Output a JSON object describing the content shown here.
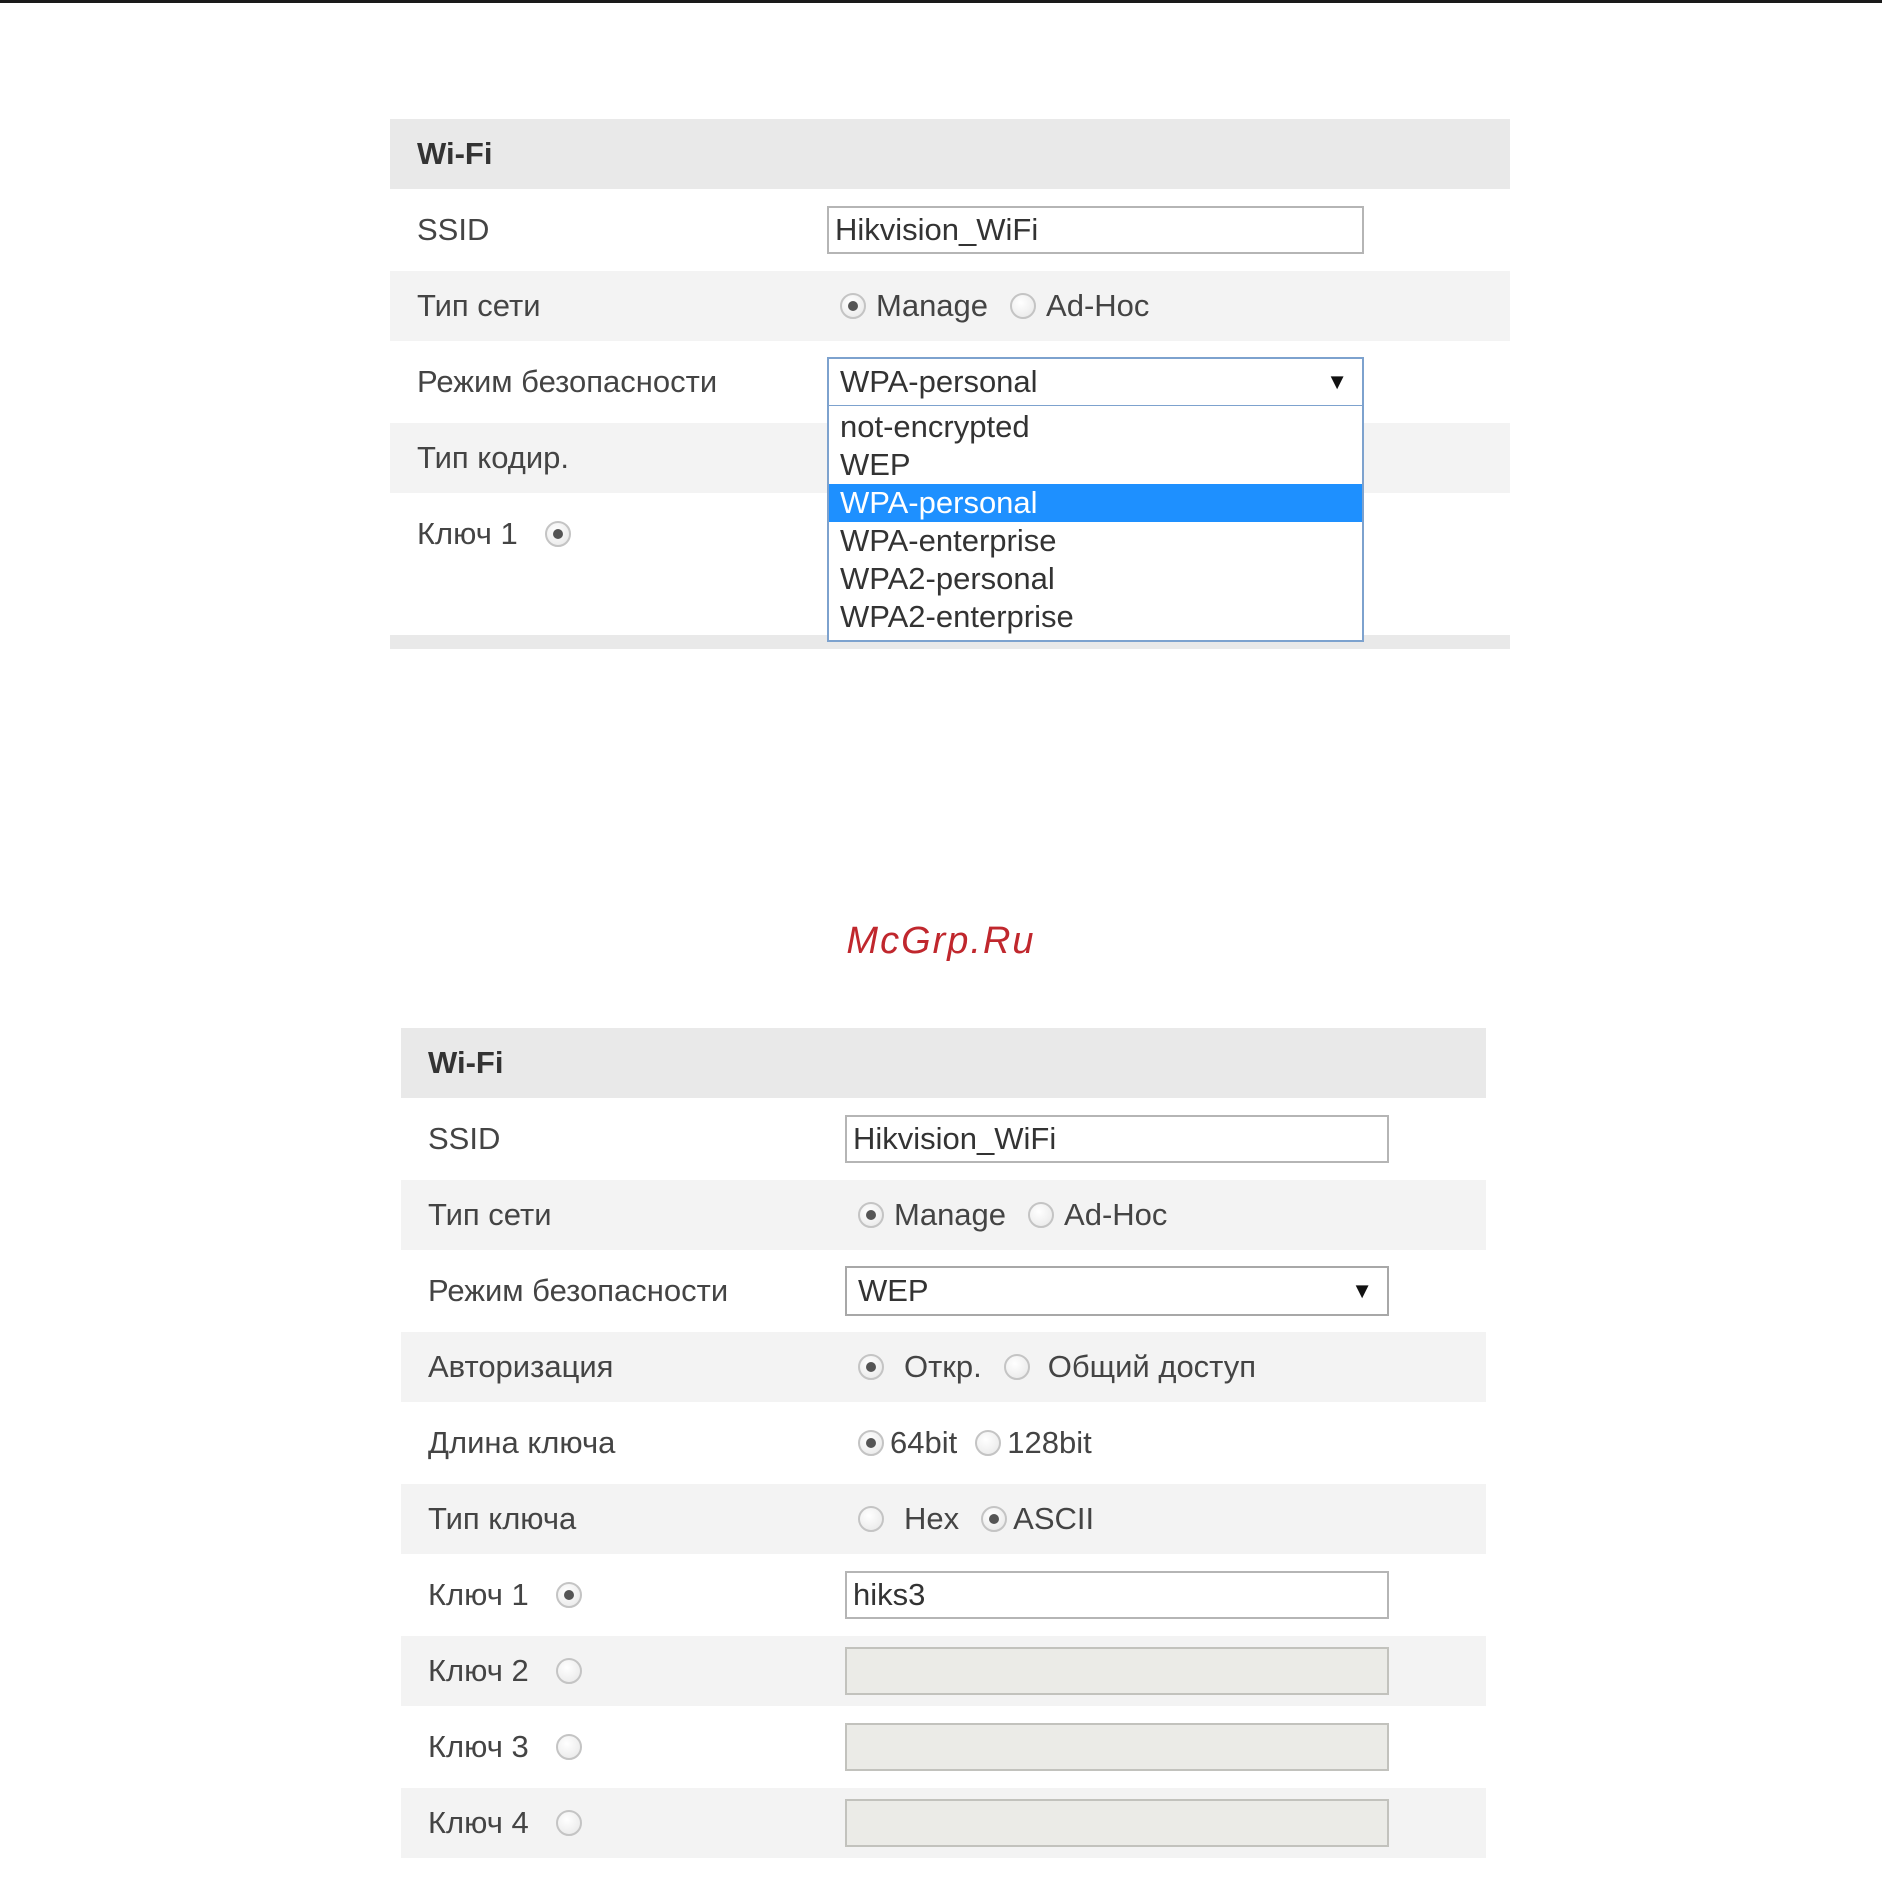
{
  "panel_top": {
    "title": "Wi-Fi",
    "ssid_label": "SSID",
    "ssid_value": "Hikvision_WiFi",
    "network_type_label": "Тип сети",
    "network_type_options": [
      "Manage",
      "Ad-Hoc"
    ],
    "network_type_selected": "Manage",
    "security_mode_label": "Режим безопасности",
    "security_mode_value": "WPA-personal",
    "security_mode_arrow": "▼",
    "security_mode_options": [
      "not-encrypted",
      "WEP",
      "WPA-personal",
      "WPA-enterprise",
      "WPA2-personal",
      "WPA2-enterprise"
    ],
    "security_mode_highlighted": "WPA-personal",
    "encryption_type_label": "Тип кодир.",
    "key1_label": "Ключ 1"
  },
  "watermark": "McGrp.Ru",
  "panel_bottom": {
    "title": "Wi-Fi",
    "ssid_label": "SSID",
    "ssid_value": "Hikvision_WiFi",
    "network_type_label": "Тип сети",
    "network_type_options": [
      "Manage",
      "Ad-Hoc"
    ],
    "network_type_selected": "Manage",
    "security_mode_label": "Режим безопасности",
    "security_mode_value": "WEP",
    "security_mode_arrow": "▼",
    "auth_label": "Авторизация",
    "auth_options": [
      "Откр.",
      "Общий доступ"
    ],
    "auth_selected": "Откр.",
    "key_length_label": "Длина ключа",
    "key_length_options": [
      "64bit",
      "128bit"
    ],
    "key_length_selected": "64bit",
    "key_type_label": "Тип ключа",
    "key_type_options": [
      "Hex",
      "ASCII"
    ],
    "key_type_selected": "ASCII",
    "keys": [
      {
        "label": "Ключ 1",
        "value": "hiks3",
        "selected": true,
        "enabled": true
      },
      {
        "label": "Ключ 2",
        "value": "",
        "selected": false,
        "enabled": false
      },
      {
        "label": "Ключ 3",
        "value": "",
        "selected": false,
        "enabled": false
      },
      {
        "label": "Ключ 4",
        "value": "",
        "selected": false,
        "enabled": false
      }
    ]
  },
  "colors": {
    "header_bg": "#e9e9e9",
    "row_shade": "#f3f3f3",
    "highlight": "#1e90ff",
    "watermark": "#c0272d"
  }
}
